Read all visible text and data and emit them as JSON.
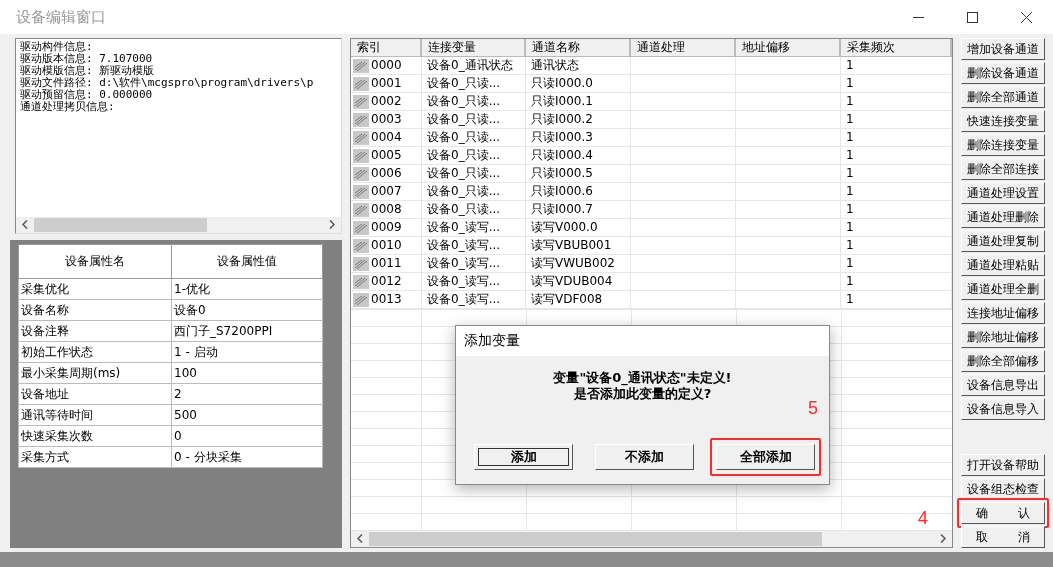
{
  "window": {
    "title": "设备编辑窗口",
    "active": false
  },
  "driver_info": {
    "lines": [
      "驱动构件信息:",
      "驱动版本信息: 7.107000",
      "驱动模版信息: 新驱动模版",
      "驱动文件路径: d:\\软件\\mcgspro\\program\\drivers\\p",
      "驱动预留信息: 0.000000",
      "通道处理拷贝信息:"
    ]
  },
  "properties": {
    "columns": [
      "设备属性名",
      "设备属性值"
    ],
    "rows": [
      [
        "采集优化",
        "1-优化"
      ],
      [
        "设备名称",
        "设备0"
      ],
      [
        "设备注释",
        "西门子_S7200PPI"
      ],
      [
        "初始工作状态",
        "1 - 启动"
      ],
      [
        "最小采集周期(ms)",
        "100"
      ],
      [
        "设备地址",
        "2"
      ],
      [
        "通讯等待时间",
        "500"
      ],
      [
        "快速采集次数",
        "0"
      ],
      [
        "采集方式",
        "0 - 分块采集"
      ]
    ]
  },
  "channels": {
    "columns": [
      "索引",
      "连接变量",
      "通道名称",
      "通道处理",
      "地址偏移",
      "采集频次"
    ],
    "rows": [
      [
        "0000",
        "设备0_通讯状态",
        "通讯状态",
        "",
        "",
        "1"
      ],
      [
        "0001",
        "设备0_只读...",
        "只读I000.0",
        "",
        "",
        "1"
      ],
      [
        "0002",
        "设备0_只读...",
        "只读I000.1",
        "",
        "",
        "1"
      ],
      [
        "0003",
        "设备0_只读...",
        "只读I000.2",
        "",
        "",
        "1"
      ],
      [
        "0004",
        "设备0_只读...",
        "只读I000.3",
        "",
        "",
        "1"
      ],
      [
        "0005",
        "设备0_只读...",
        "只读I000.4",
        "",
        "",
        "1"
      ],
      [
        "0006",
        "设备0_只读...",
        "只读I000.5",
        "",
        "",
        "1"
      ],
      [
        "0007",
        "设备0_只读...",
        "只读I000.6",
        "",
        "",
        "1"
      ],
      [
        "0008",
        "设备0_只读...",
        "只读I000.7",
        "",
        "",
        "1"
      ],
      [
        "0009",
        "设备0_读写...",
        "读写V000.0",
        "",
        "",
        "1"
      ],
      [
        "0010",
        "设备0_读写...",
        "读写VBUB001",
        "",
        "",
        "1"
      ],
      [
        "0011",
        "设备0_读写...",
        "读写VWUB002",
        "",
        "",
        "1"
      ],
      [
        "0012",
        "设备0_读写...",
        "读写VDUB004",
        "",
        "",
        "1"
      ],
      [
        "0013",
        "设备0_读写...",
        "读写VDF008",
        "",
        "",
        "1"
      ]
    ]
  },
  "side_buttons": {
    "top": [
      {
        "label": "增加设备通道",
        "highlighted": false
      },
      {
        "label": "删除设备通道",
        "highlighted": false
      },
      {
        "label": "删除全部通道",
        "highlighted": false
      },
      {
        "label": "快速连接变量",
        "highlighted": false
      },
      {
        "label": "删除连接变量",
        "highlighted": false
      },
      {
        "label": "删除全部连接",
        "highlighted": false
      },
      {
        "label": "通道处理设置",
        "highlighted": false
      },
      {
        "label": "通道处理删除",
        "highlighted": false
      },
      {
        "label": "通道处理复制",
        "highlighted": false
      },
      {
        "label": "通道处理粘贴",
        "highlighted": false
      },
      {
        "label": "通道处理全删",
        "highlighted": false
      },
      {
        "label": "连接地址偏移",
        "highlighted": false
      },
      {
        "label": "删除地址偏移",
        "highlighted": false
      },
      {
        "label": "删除全部偏移",
        "highlighted": false
      },
      {
        "label": "设备信息导出",
        "highlighted": false
      },
      {
        "label": "设备信息导入",
        "highlighted": false
      }
    ],
    "bottom": [
      {
        "label": "打开设备帮助",
        "highlighted": false
      },
      {
        "label": "设备组态检查",
        "highlighted": false
      },
      {
        "label": "确        认",
        "highlighted": true,
        "annotation": "4"
      },
      {
        "label": "取        消",
        "highlighted": false
      }
    ]
  },
  "dialog": {
    "title": "添加变量",
    "message": [
      "变量\"设备0_通讯状态\"未定义!",
      "是否添加此变量的定义?"
    ],
    "annotation": "5",
    "buttons": [
      {
        "label": "添加",
        "focused": true,
        "highlighted": false
      },
      {
        "label": "不添加",
        "focused": false,
        "highlighted": false
      },
      {
        "label": "全部添加",
        "focused": false,
        "highlighted": true
      }
    ]
  }
}
